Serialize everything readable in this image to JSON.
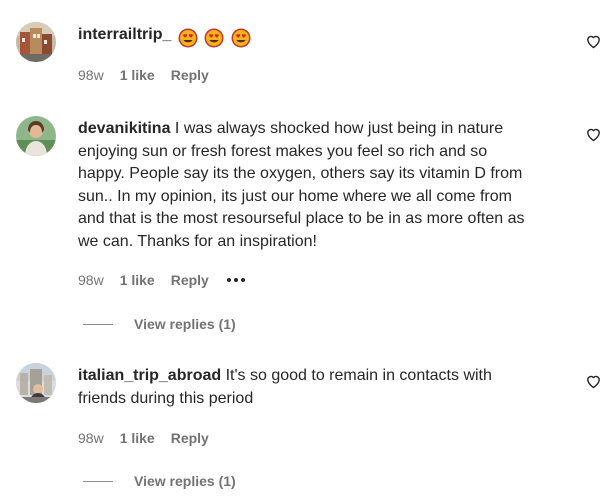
{
  "comments": [
    {
      "username": "interrailtrip_",
      "text": "",
      "emojis": [
        "heart-eyes-emoji",
        "heart-eyes-emoji",
        "heart-eyes-emoji"
      ],
      "time": "98w",
      "likes": "1 like",
      "reply_label": "Reply"
    },
    {
      "username": "devanikitina",
      "text_lines": [
        " I was always shocked how just being in nature",
        "enjoying sun or fresh forest makes you feel so rich and so",
        "happy. People say its the oxygen, others say its vitamin D from",
        "sun.. In my opinion, its just our home where we all come from",
        "and that is the most resourseful place to be in as more often as",
        "we can. Thanks for an inspiration!"
      ],
      "time": "98w",
      "likes": "1 like",
      "reply_label": "Reply",
      "view_replies": "View replies (1)"
    },
    {
      "username": "italian_trip_abroad",
      "text_lines": [
        " It's so good to remain in contacts with",
        "friends during this period"
      ],
      "time": "98w",
      "likes": "1 like",
      "reply_label": "Reply",
      "view_replies": "View replies (1)"
    }
  ],
  "colors": {
    "text": "#262626",
    "secondary": "#737373",
    "line": "#8e8e8e"
  },
  "icons": {
    "like": "heart-outline-icon",
    "more": "more-options-icon"
  }
}
